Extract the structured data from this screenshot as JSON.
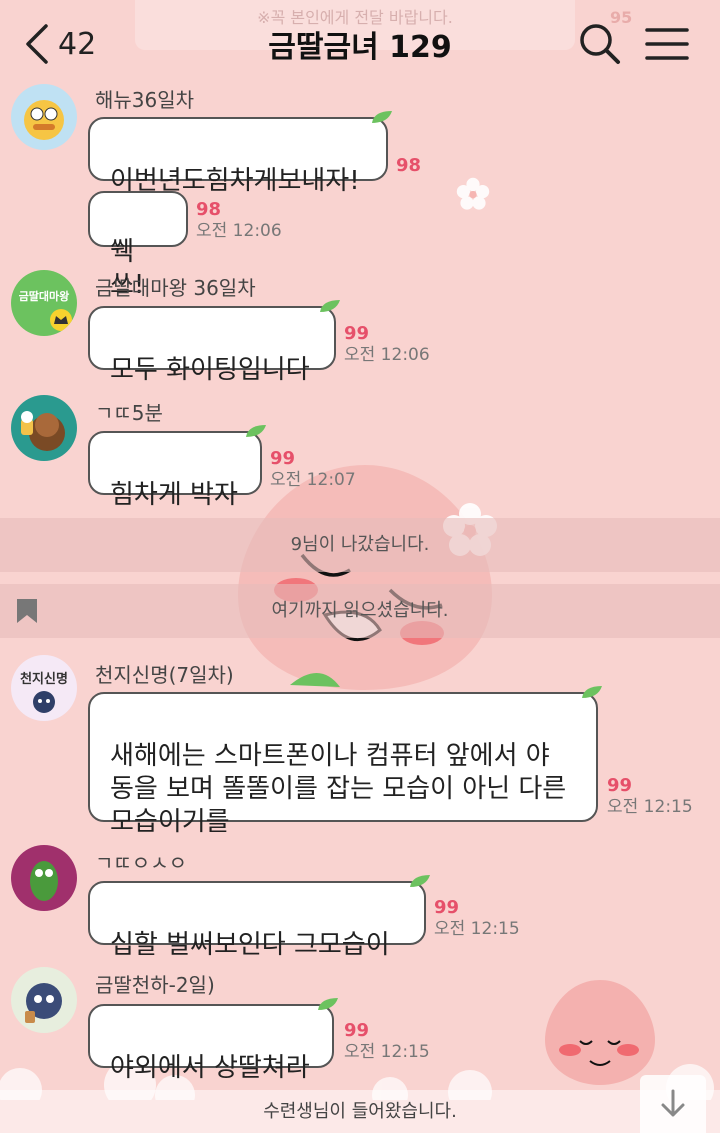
{
  "header": {
    "back_count": "42",
    "title": "금딸금녀 129",
    "ghost_notice": "※꼭 본인에게 전달 바랍니다.",
    "ghost_count": "95"
  },
  "messages": [
    {
      "sender": "해뉴36일차",
      "bubbles": [
        {
          "text": "이번년도힘차게보내자!",
          "unread": "98",
          "time": ""
        },
        {
          "text": "쒝쓰!",
          "unread": "98",
          "time": "오전 12:06"
        }
      ]
    },
    {
      "sender": "금딸대마왕 36일차",
      "avatar_text": "금딸대마왕",
      "bubbles": [
        {
          "text": "모두 화이팅입니다",
          "unread": "99",
          "time": "오전 12:06"
        }
      ]
    },
    {
      "sender": "ㄱㄸ5분",
      "bubbles": [
        {
          "text": "힘차게 박자",
          "unread": "99",
          "time": "오전 12:07"
        }
      ]
    },
    {
      "sender": "천지신명(7일차)",
      "avatar_text": "천지신명",
      "bubbles": [
        {
          "text": "새해에는 스마트폰이나 컴퓨터 앞에서 야\n동을 보며 똘똘이를 잡는 모습이 아닌 다른\n모습이기를",
          "unread": "99",
          "time": "오전 12:15"
        }
      ]
    },
    {
      "sender": "ㄱㄸㅇㅅㅇ",
      "bubbles": [
        {
          "text": "십할 벌써보인다  그모습이",
          "unread": "99",
          "time": "오전 12:15"
        }
      ]
    },
    {
      "sender": "금딸천하-2일)",
      "bubbles": [
        {
          "text": "야외에서 상딸쳐라",
          "unread": "99",
          "time": "오전 12:15"
        }
      ]
    }
  ],
  "system": {
    "left_notice": "9님이 나갔습니다.",
    "read_marker": "여기까지 읽으셨습니다.",
    "joined_notice": "수련생님이 들어왔습니다."
  },
  "colors": {
    "background": "#f9d3d0",
    "unread": "#e6506a",
    "bubble": "#ffffff"
  }
}
